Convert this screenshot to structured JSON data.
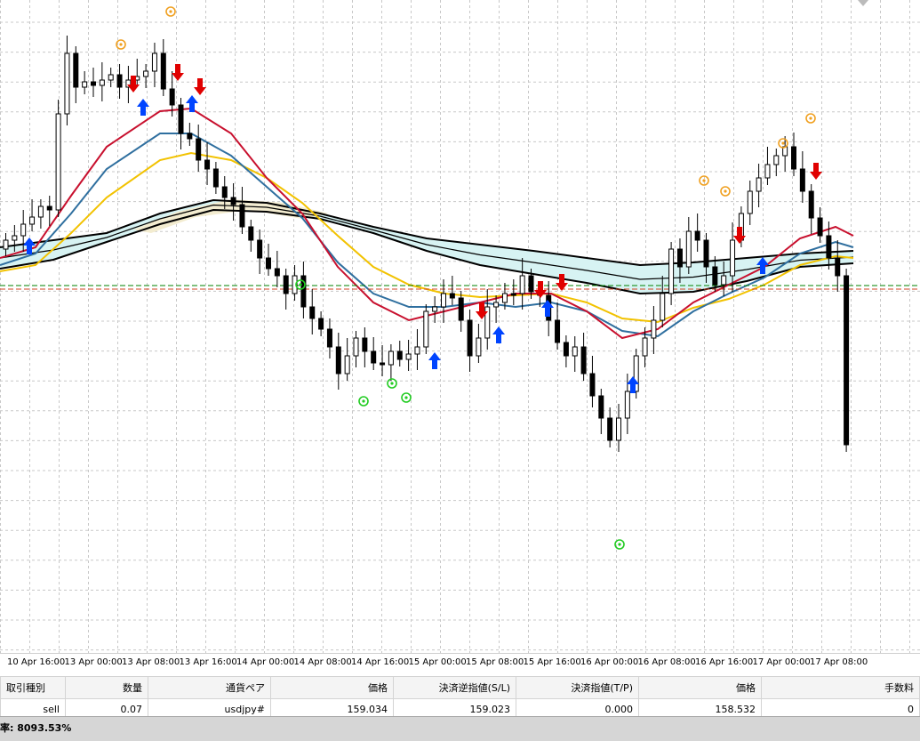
{
  "chart": {
    "symbol": "usdjpy",
    "time_labels": [
      "10 Apr 16:00",
      "13 Apr 00:00",
      "13 Apr 08:00",
      "13 Apr 16:00",
      "14 Apr 00:00",
      "14 Apr 08:00",
      "14 Apr 16:00",
      "15 Apr 00:00",
      "15 Apr 08:00",
      "15 Apr 16:00",
      "16 Apr 00:00",
      "16 Apr 08:00",
      "16 Apr 16:00",
      "17 Apr 00:00",
      "17 Apr 08:00"
    ],
    "colors": {
      "background": "#ffffff",
      "grid": "#c8c8c8",
      "candle": "#000000",
      "ma_fast": "#c8102e",
      "ma_mid": "#2f6f9f",
      "ma_slow": "#f2c200",
      "ribbon_fill_cyan": "#d7f3f3",
      "ribbon_fill_beige": "#f3ecd0",
      "signal_down_arrow": "#e00000",
      "signal_up_arrow": "#0044ff",
      "top_marker": "#f0a020",
      "bottom_marker": "#22cc22",
      "green_level_line": "#008000",
      "red_level_line": "#d04020"
    },
    "arrows_down_count": 8,
    "arrows_up_count": 9
  },
  "table": {
    "headers": [
      "取引種別",
      "数量",
      "通貨ペア",
      "価格",
      "決済逆指値(S/L)",
      "決済指値(T/P)",
      "価格",
      "手数料"
    ],
    "rows": [
      [
        "sell",
        "0.07",
        "usdjpy#",
        "159.034",
        "159.023",
        "0.000",
        "158.532",
        "0"
      ]
    ]
  },
  "status": {
    "text": "率: 8093.53%"
  }
}
